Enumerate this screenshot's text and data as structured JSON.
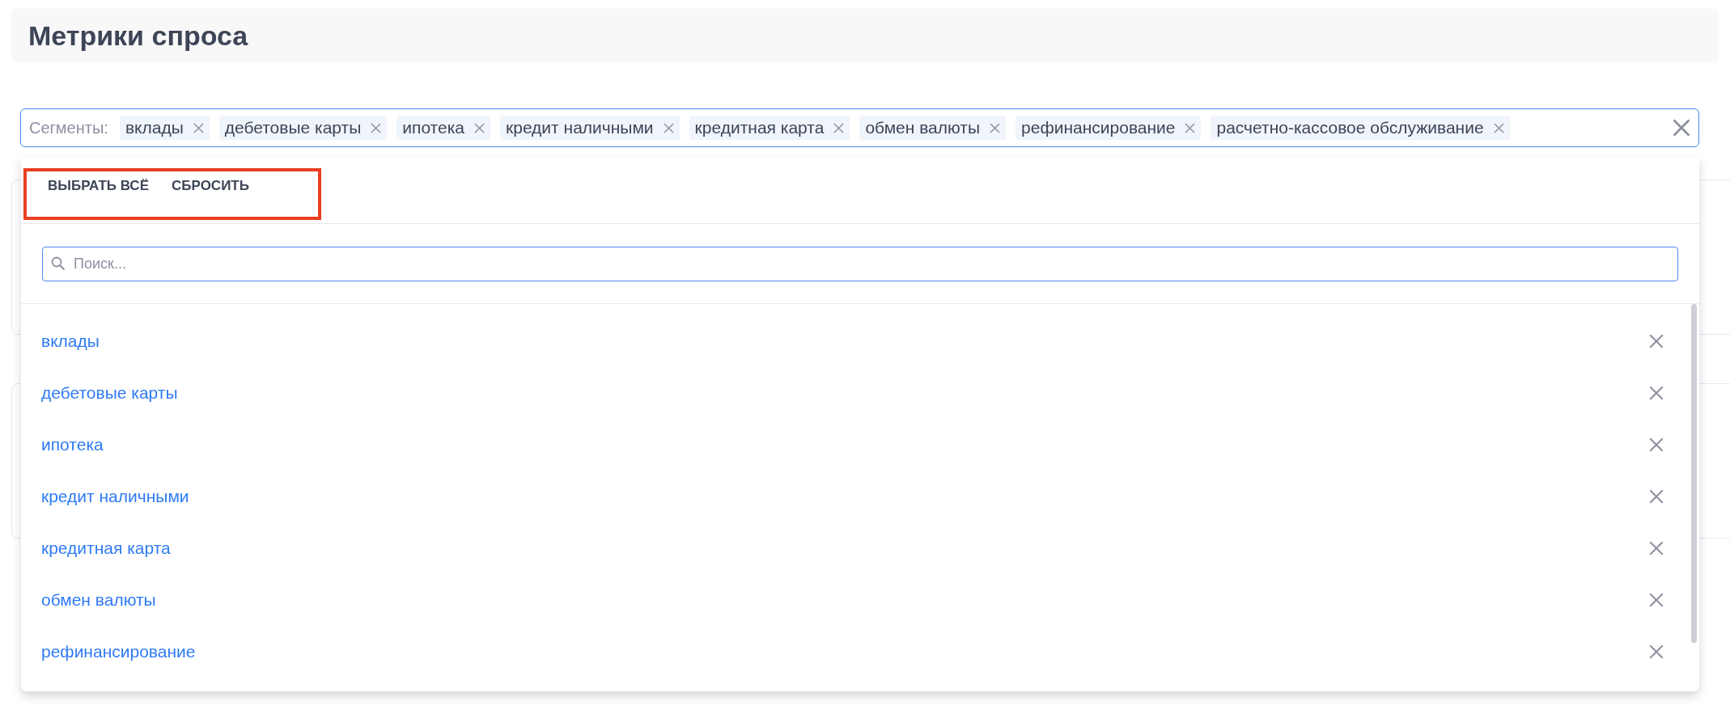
{
  "page": {
    "title": "Метрики спроса"
  },
  "segments": {
    "label": "Сегменты:",
    "tags": [
      "вклады",
      "дебетовые карты",
      "ипотека",
      "кредит наличными",
      "кредитная карта",
      "обмен валюты",
      "рефинансирование",
      "расчетно-кассовое обслуживание"
    ],
    "dropdown": {
      "actions": [
        "ВЫБРАТЬ ВСЁ",
        "СБРОСИТЬ"
      ],
      "search": {
        "placeholder": "Поиск..."
      },
      "options": [
        {
          "label": "вклады",
          "selected": true
        },
        {
          "label": "дебетовые карты",
          "selected": true
        },
        {
          "label": "ипотека",
          "selected": true
        },
        {
          "label": "кредит наличными",
          "selected": true
        },
        {
          "label": "кредитная карта",
          "selected": true
        },
        {
          "label": "обмен валюты",
          "selected": true
        },
        {
          "label": "рефинансирование",
          "selected": true
        }
      ]
    }
  }
}
